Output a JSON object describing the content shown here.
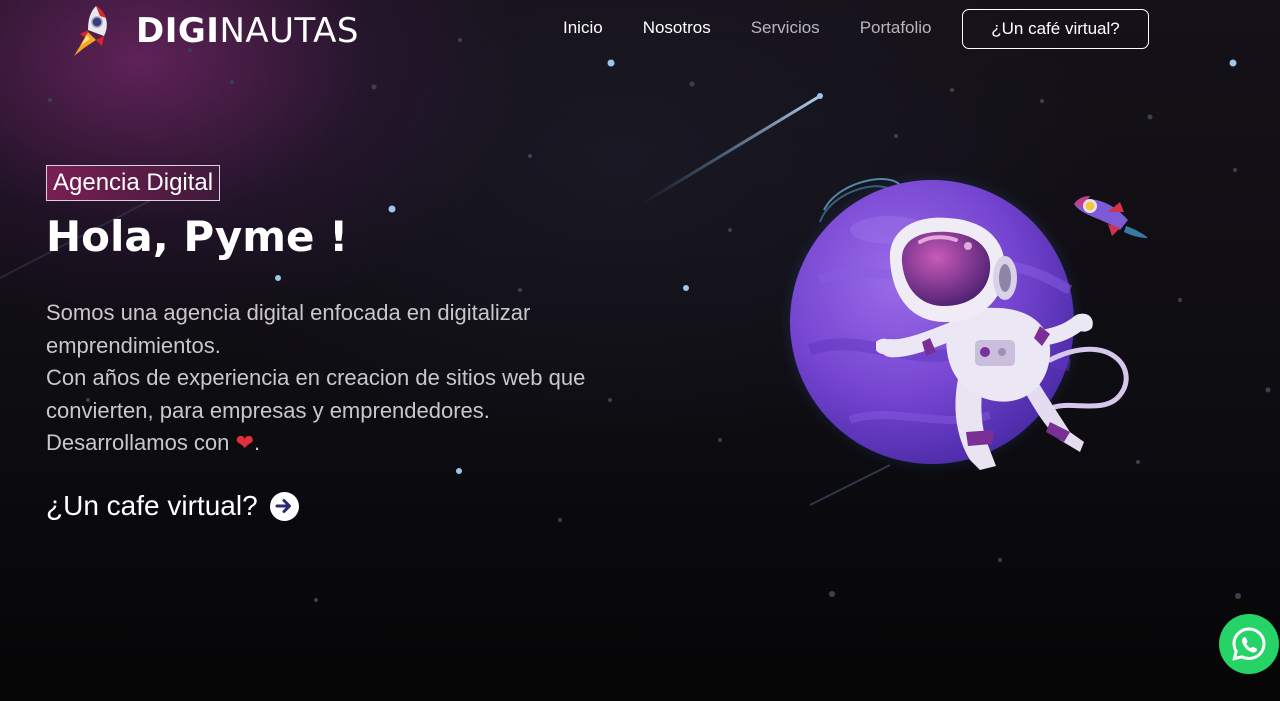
{
  "brand": {
    "name_bold": "DIGI",
    "name_light": "NAUTAS",
    "logo_icon": "rocket-icon"
  },
  "nav": {
    "items": [
      {
        "label": "Inicio",
        "state": "normal"
      },
      {
        "label": "Nosotros",
        "state": "normal"
      },
      {
        "label": "Servicios",
        "state": "dim"
      },
      {
        "label": "Portafolio",
        "state": "dim"
      }
    ],
    "cta_label": "¿Un café virtual?"
  },
  "hero": {
    "badge": "Agencia Digital",
    "headline": "Hola, Pyme !",
    "description_lines": [
      "Somos una agencia digital enfocada en digitalizar emprendimientos.",
      "Con años de experiencia en creacion de sitios web que convierten, para empresas y emprendedores.",
      "Desarrollamos con"
    ],
    "heart_icon": "heart-icon",
    "description_end": ".",
    "cta_label": "¿Un cafe virtual?",
    "cta_icon": "arrow-right-circle-icon"
  },
  "illustration": {
    "main": "astronaut-planet-illustration",
    "secondary": "rocket-icon"
  },
  "floating": {
    "whatsapp_icon": "whatsapp-icon"
  },
  "colors": {
    "background": "#0a0a0d",
    "accent_magenta": "#7a1f55",
    "planet_purple": "#7b4fd6",
    "whatsapp_green": "#25d366",
    "heart_red": "#e0303c",
    "text_white": "#ffffff",
    "text_muted": "#c9c6cc"
  }
}
